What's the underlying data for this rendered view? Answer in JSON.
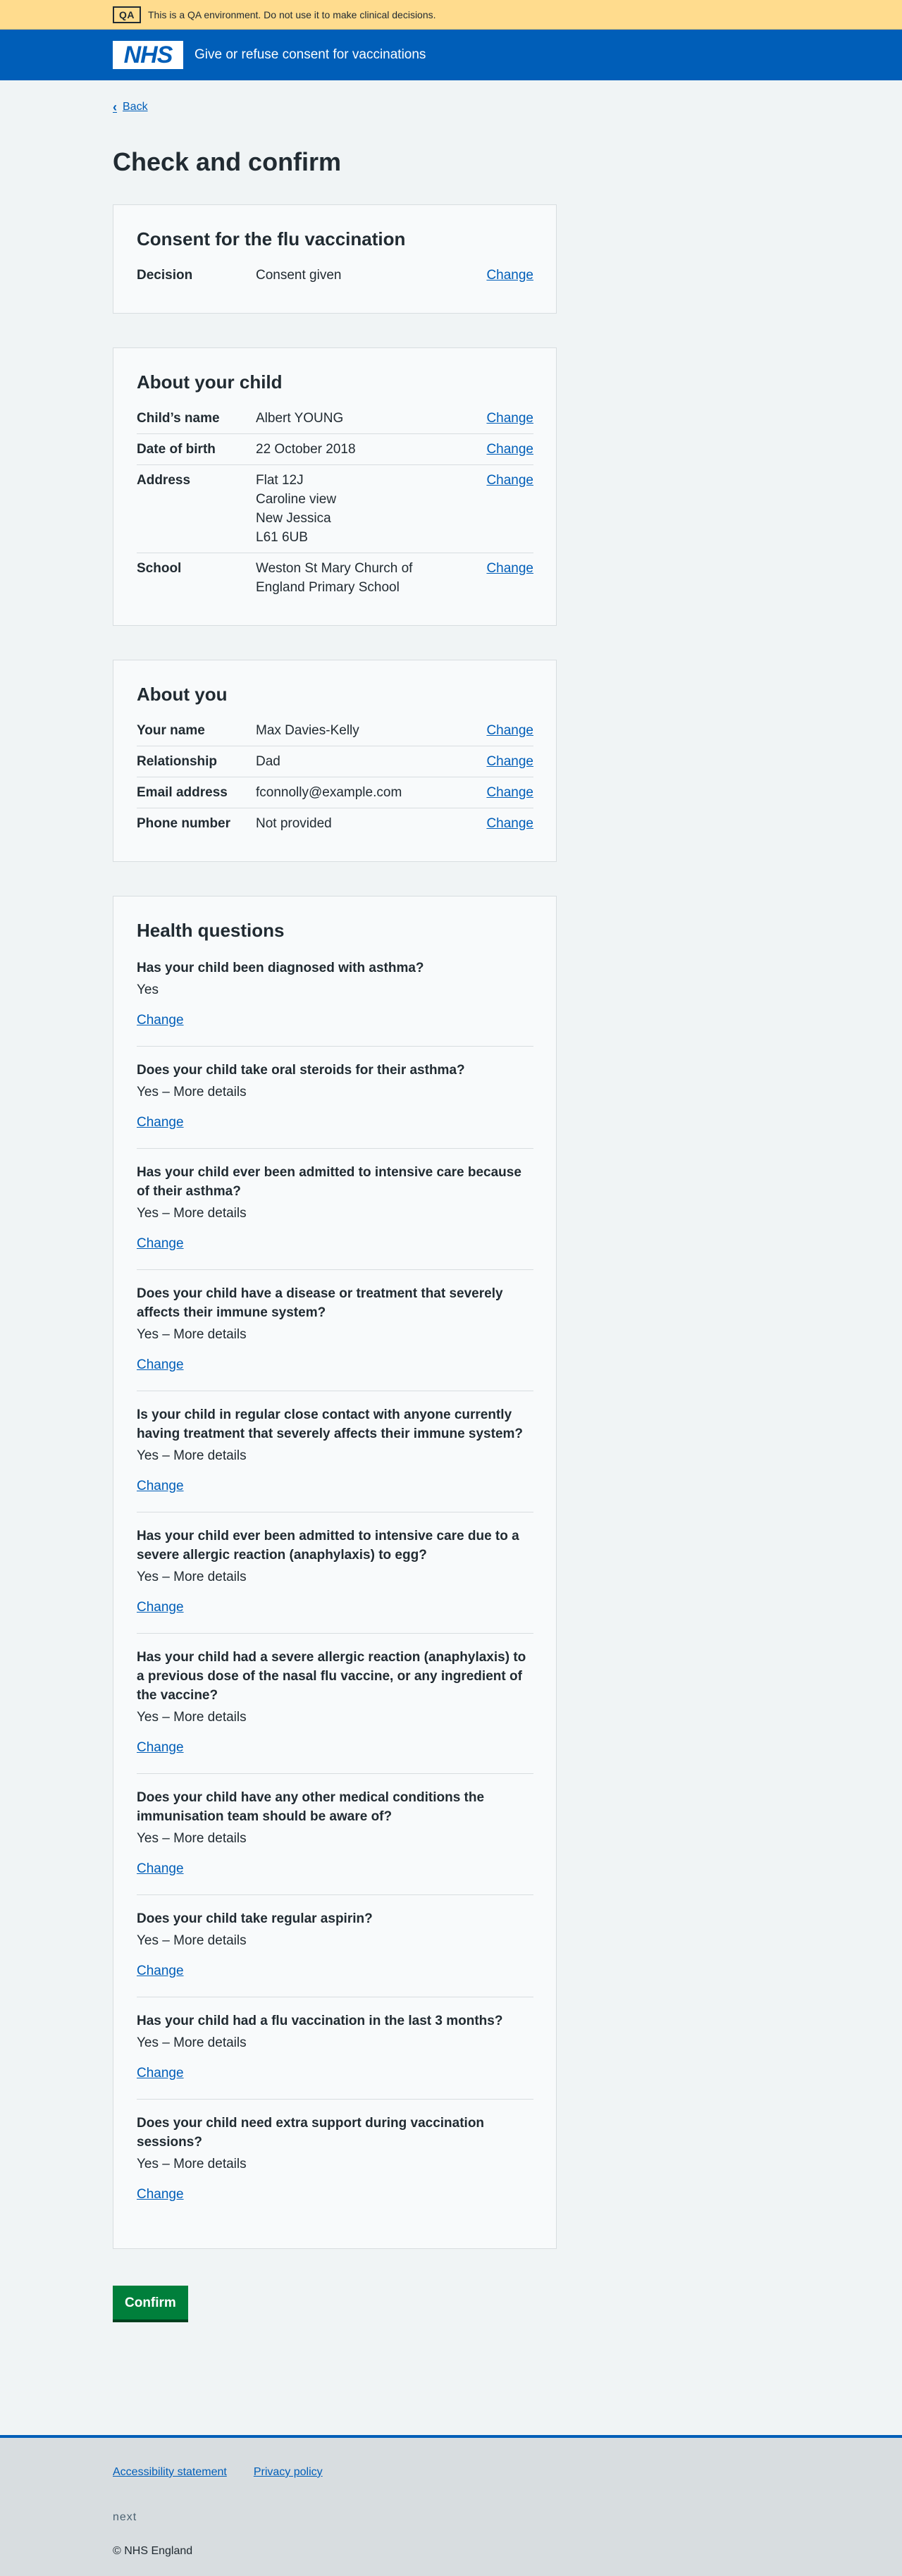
{
  "env_banner": {
    "tag": "QA",
    "text": "This is a QA environment. Do not use it to make clinical decisions."
  },
  "header": {
    "logo": "NHS",
    "service": "Give or refuse consent for vaccinations"
  },
  "back": {
    "label": "Back",
    "icon": "chevron-left-icon"
  },
  "page_title": "Check and confirm",
  "consent": {
    "title": "Consent for the flu vaccination",
    "rows": [
      {
        "key": "Decision",
        "value": "Consent given",
        "action": "Change"
      }
    ]
  },
  "child": {
    "title": "About your child",
    "rows": [
      {
        "key": "Child’s name",
        "value": "Albert YOUNG",
        "action": "Change"
      },
      {
        "key": "Date of birth",
        "value": "22 October 2018",
        "action": "Change"
      },
      {
        "key": "Address",
        "value_lines": [
          "Flat 12J",
          "Caroline view",
          "New Jessica",
          "L61 6UB"
        ],
        "action": "Change"
      },
      {
        "key": "School",
        "value_lines": [
          "Weston St Mary Church of",
          "England Primary School"
        ],
        "action": "Change"
      }
    ]
  },
  "you": {
    "title": "About you",
    "rows": [
      {
        "key": "Your name",
        "value": "Max Davies-Kelly",
        "action": "Change"
      },
      {
        "key": "Relationship",
        "value": "Dad",
        "action": "Change"
      },
      {
        "key": "Email address",
        "value": "fconnolly@example.com",
        "action": "Change"
      },
      {
        "key": "Phone number",
        "value": "Not provided",
        "action": "Change"
      }
    ]
  },
  "health": {
    "title": "Health questions",
    "items": [
      {
        "question": "Has your child been diagnosed with asthma?",
        "answer": "Yes",
        "action": "Change"
      },
      {
        "question": "Does your child take oral steroids for their asthma?",
        "answer": "Yes – More details",
        "action": "Change"
      },
      {
        "question": "Has your child ever been admitted to intensive care because of their asthma?",
        "answer": "Yes – More details",
        "action": "Change"
      },
      {
        "question": "Does your child have a disease or treatment that severely affects their immune system?",
        "answer": "Yes – More details",
        "action": "Change"
      },
      {
        "question": "Is your child in regular close contact with anyone currently having treatment that severely affects their immune system?",
        "answer": "Yes – More details",
        "action": "Change"
      },
      {
        "question": "Has your child ever been admitted to intensive care due to a severe allergic reaction (anaphylaxis) to egg?",
        "answer": "Yes – More details",
        "action": "Change"
      },
      {
        "question": "Has your child had a severe allergic reaction (anaphylaxis) to a previous dose of the nasal flu vaccine, or any ingredient of the vaccine?",
        "answer": "Yes – More details",
        "action": "Change"
      },
      {
        "question": "Does your child have any other medical conditions the immunisation team should be aware of?",
        "answer": "Yes – More details",
        "action": "Change"
      },
      {
        "question": "Does your child take regular aspirin?",
        "answer": "Yes – More details",
        "action": "Change"
      },
      {
        "question": "Has your child had a flu vaccination in the last 3 months?",
        "answer": "Yes – More details",
        "action": "Change"
      },
      {
        "question": "Does your child need extra support during vaccination sessions?",
        "answer": "Yes – More details",
        "action": "Change"
      }
    ]
  },
  "confirm_label": "Confirm",
  "footer": {
    "links": [
      "Accessibility statement",
      "Privacy policy"
    ],
    "meta": "next",
    "copyright": "© NHS England"
  },
  "colors": {
    "nhs_blue": "#005eb8",
    "confirm_green": "#007f3b",
    "banner_yellow": "#ffdc8e"
  }
}
